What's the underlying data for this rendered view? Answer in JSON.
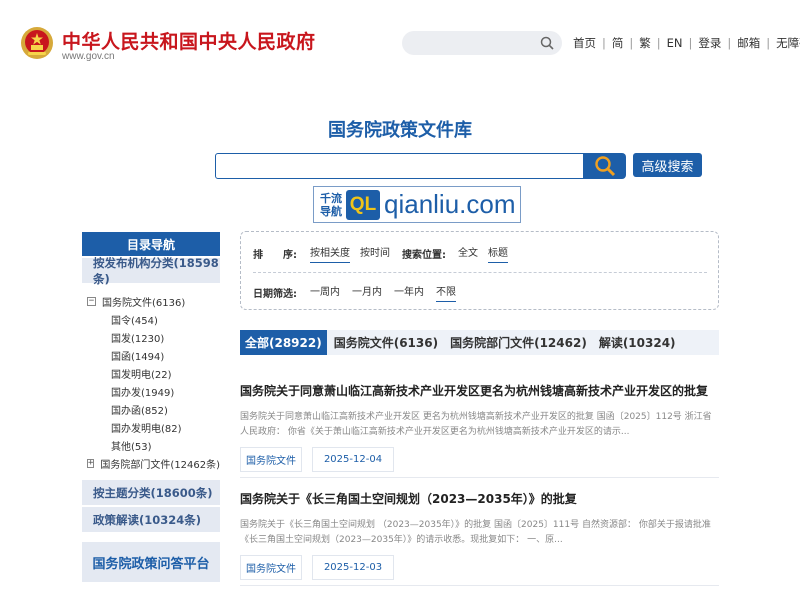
{
  "header": {
    "site_title": "中华人民共和国中央人民政府",
    "site_url": "www.gov.cn",
    "search_placeholder": "",
    "nav": [
      "首页",
      "简",
      "繁",
      "EN",
      "登录",
      "邮箱",
      "无障碍"
    ]
  },
  "page": {
    "title": "国务院政策文件库",
    "search_value": "",
    "advanced_search_label": "高级搜索"
  },
  "watermark": {
    "nav_line1": "千流",
    "nav_line2": "导航",
    "logo": "QL",
    "text": "qianliu.com"
  },
  "sidebar": {
    "title": "目录导航",
    "by_org": "按发布机构分类(18598条)",
    "tree": [
      {
        "label": "国务院文件(6136)",
        "level": 1,
        "toggle": "−"
      },
      {
        "label": "国令(454)",
        "level": 2
      },
      {
        "label": "国发(1230)",
        "level": 2
      },
      {
        "label": "国函(1494)",
        "level": 2
      },
      {
        "label": "国发明电(22)",
        "level": 2
      },
      {
        "label": "国办发(1949)",
        "level": 2
      },
      {
        "label": "国办函(852)",
        "level": 2
      },
      {
        "label": "国办发明电(82)",
        "level": 2
      },
      {
        "label": "其他(53)",
        "level": 2
      },
      {
        "label": "国务院部门文件(12462条)",
        "level": 1,
        "toggle": "+"
      }
    ],
    "by_topic": "按主题分类(18600条)",
    "policy_interpretation": "政策解读(10324条)",
    "qa_platform": "国务院政策问答平台"
  },
  "filter": {
    "sort_label": "排　　序:",
    "sort_options": [
      "按相关度",
      "按时间"
    ],
    "position_label": "搜索位置:",
    "position_options": [
      "全文",
      "标题"
    ],
    "date_label": "日期筛选:",
    "date_options": [
      "一周内",
      "一月内",
      "一年内",
      "不限"
    ]
  },
  "tabs": [
    "全部(28922)",
    "国务院文件(6136)",
    "国务院部门文件(12462)",
    "解读(10324)"
  ],
  "results": [
    {
      "title": "国务院关于同意萧山临江高新技术产业开发区更名为杭州钱塘高新技术产业开发区的批复",
      "summary": "国务院关于同意萧山临江高新技术产业开发区 更名为杭州钱塘高新技术产业开发区的批复 国函〔2025〕112号 浙江省人民政府： 你省《关于萧山临江高新技术产业开发区更名为杭州钱塘高新技术产业开发区的请示...",
      "category": "国务院文件",
      "date": "2025-12-04"
    },
    {
      "title": "国务院关于《长三角国土空间规划（2023—2035年）》的批复",
      "summary": "国务院关于《长三角国土空间规划 （2023—2035年）》的批复 国函〔2025〕111号 自然资源部： 你部关于报请批准《长三角国土空间规划（2023—2035年）》的请示收悉。现批复如下： 一、原...",
      "category": "国务院文件",
      "date": "2025-12-03"
    }
  ],
  "colors": {
    "brand_red": "#c8161d",
    "brand_blue": "#1d5ea8"
  }
}
